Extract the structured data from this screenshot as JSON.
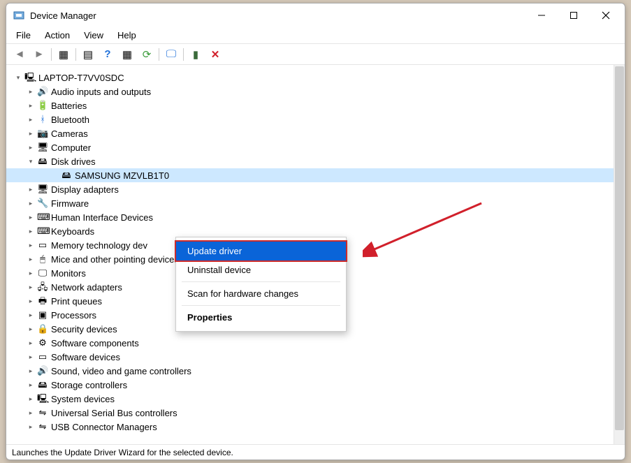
{
  "window": {
    "title": "Device Manager"
  },
  "menubar": [
    "File",
    "Action",
    "View",
    "Help"
  ],
  "toolbar": {
    "back": "back-icon",
    "forward": "forward-icon",
    "up": "show-hidden-icon",
    "properties": "properties-icon",
    "help": "help-icon",
    "refresh": "refresh-icon",
    "update": "update-icon",
    "monitor": "display-icon",
    "plug": "plug-icon",
    "delete": "delete-icon"
  },
  "tree": {
    "root": "LAPTOP-T7VV0SDC",
    "categories": [
      {
        "label": "Audio inputs and outputs",
        "icon": "🔊"
      },
      {
        "label": "Batteries",
        "icon": "🔋"
      },
      {
        "label": "Bluetooth",
        "icon": "ᚼ",
        "color": "#1e6fd9"
      },
      {
        "label": "Cameras",
        "icon": "📷"
      },
      {
        "label": "Computer",
        "icon": "🖥"
      },
      {
        "label": "Disk drives",
        "icon": "🖴",
        "expanded": true,
        "children": [
          {
            "label": "SAMSUNG MZVLB1T0",
            "icon": "🖴",
            "selected": true
          }
        ]
      },
      {
        "label": "Display adapters",
        "icon": "🖥"
      },
      {
        "label": "Firmware",
        "icon": "🔧"
      },
      {
        "label": "Human Interface Devices",
        "icon": "⌨",
        "truncated": "Human Interface Devices"
      },
      {
        "label": "Keyboards",
        "icon": "⌨"
      },
      {
        "label": "Memory technology dev",
        "icon": "▭"
      },
      {
        "label": "Mice and other pointing devices",
        "icon": "🖱"
      },
      {
        "label": "Monitors",
        "icon": "🖵"
      },
      {
        "label": "Network adapters",
        "icon": "🖧"
      },
      {
        "label": "Print queues",
        "icon": "🖶"
      },
      {
        "label": "Processors",
        "icon": "▣"
      },
      {
        "label": "Security devices",
        "icon": "🔒"
      },
      {
        "label": "Software components",
        "icon": "⚙"
      },
      {
        "label": "Software devices",
        "icon": "▭"
      },
      {
        "label": "Sound, video and game controllers",
        "icon": "🔊"
      },
      {
        "label": "Storage controllers",
        "icon": "🖴"
      },
      {
        "label": "System devices",
        "icon": "🖳"
      },
      {
        "label": "Universal Serial Bus controllers",
        "icon": "⇋"
      },
      {
        "label": "USB Connector Managers",
        "icon": "⇋"
      }
    ]
  },
  "contextMenu": {
    "items": [
      {
        "label": "Update driver",
        "highlighted": true
      },
      {
        "label": "Uninstall device"
      },
      {
        "sep": true
      },
      {
        "label": "Scan for hardware changes"
      },
      {
        "sep": true
      },
      {
        "label": "Properties",
        "bold": true
      }
    ]
  },
  "statusbar": "Launches the Update Driver Wizard for the selected device.",
  "annotation": {
    "arrow_color": "#d1202b"
  }
}
